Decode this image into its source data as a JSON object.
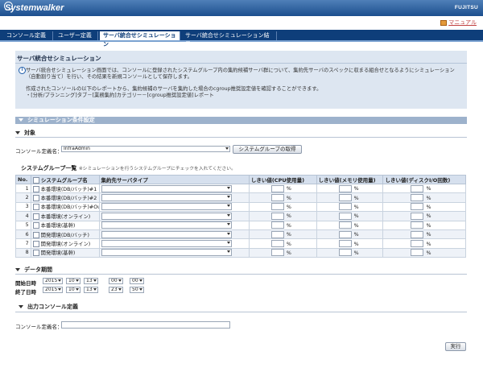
{
  "header": {
    "brand": "Systemwalker",
    "vendor": "FUJITSU",
    "manual_link": "マニュアル"
  },
  "tabs": [
    {
      "label": "コンソール定義",
      "active": false
    },
    {
      "label": "ユーザー定義",
      "active": false
    },
    {
      "label": "サーバ統合せシミュレーション",
      "active": true
    },
    {
      "label": "サーバ統合せシミュレーション結果",
      "active": false
    }
  ],
  "intro": {
    "title": "サーバ統合せシミュレーション",
    "line1": "サーバ統合せシミュレーション画面では、コンソールに登録されたシステムグループ内の集約候補サーバ群について、集約先サーバのスペックに収まる組合せとなるようにシミュレーション",
    "line2": "（自動割り当て）を行い、その結果を新規コンソールとして保存します。",
    "line3": "作成されたコンソールの以下のレポートから、集約候補のサーバを集約した場合のcgroup推奨設定値を確認することができます。",
    "line4": "・[分析/プランニング]タブ－[業務集約]カテゴリー－[cgroup推奨設定値]レポート"
  },
  "sim_section": {
    "title": "シミュレーション条件設定",
    "target_heading": "対象",
    "console_label": "コンソール定義名：",
    "console_value": "InfraAdmin",
    "get_groups_button": "システムグループの取得",
    "groups_heading": "システムグループ一覧",
    "groups_hint": "※シミュレーションを行うシステムグループにチェックを入れてください。"
  },
  "table": {
    "headers": {
      "no": "No.",
      "name": "システムグループ名",
      "type": "集約先サーバタイプ",
      "cpu": "しきい値(CPU使用量)",
      "mem": "しきい値(メモリ使用量)",
      "disk": "しきい値(ディスクI/O回数)"
    },
    "unit": "%",
    "rows": [
      {
        "no": "1",
        "name": "本番環境(DB/バッチ)#1",
        "type": ""
      },
      {
        "no": "2",
        "name": "本番環境(DB/バッチ)#2",
        "type": ""
      },
      {
        "no": "3",
        "name": "本番環境(DB/バッチ)#OutOfSpec",
        "type": ""
      },
      {
        "no": "4",
        "name": "本番環境(オンライン)",
        "type": ""
      },
      {
        "no": "5",
        "name": "本番環境(基幹)",
        "type": ""
      },
      {
        "no": "6",
        "name": "開発環境(DB/バッチ)",
        "type": ""
      },
      {
        "no": "7",
        "name": "開発環境(オンライン)",
        "type": ""
      },
      {
        "no": "8",
        "name": "開発環境(基幹)",
        "type": ""
      }
    ]
  },
  "period": {
    "heading": "データ期間",
    "start_label": "開始日時",
    "end_label": "終了日時",
    "start": [
      "2015",
      "10",
      "13",
      "00",
      "00"
    ],
    "end": [
      "2015",
      "10",
      "13",
      "23",
      "50"
    ]
  },
  "output": {
    "heading": "出力コンソール定義",
    "name_label": "コンソール定義名：",
    "name_value": ""
  },
  "run_button": "実行",
  "colors": {
    "header_blue": "#1c4f8e",
    "tabstrip_navy": "#0e3e7a",
    "section_bar": "#9db2cc",
    "info_panel": "#dde6f1"
  }
}
